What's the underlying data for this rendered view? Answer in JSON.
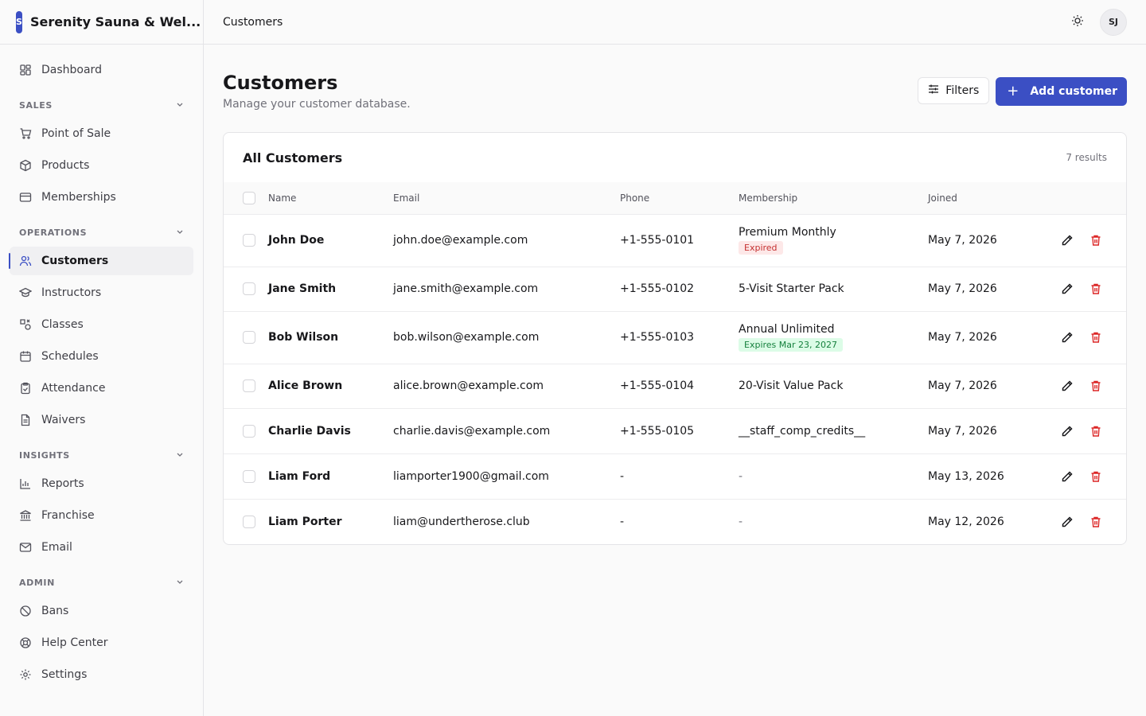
{
  "app": {
    "logo_letter": "S",
    "name": "Serenity Sauna & Wel..."
  },
  "topbar": {
    "breadcrumb": "Customers",
    "avatar_initials": "SJ"
  },
  "sidebar": {
    "dashboard": "Dashboard",
    "sections": {
      "sales": "SALES",
      "operations": "OPERATIONS",
      "insights": "INSIGHTS",
      "admin": "ADMIN"
    },
    "items": {
      "point_of_sale": "Point of Sale",
      "products": "Products",
      "memberships": "Memberships",
      "customers": "Customers",
      "instructors": "Instructors",
      "classes": "Classes",
      "schedules": "Schedules",
      "attendance": "Attendance",
      "waivers": "Waivers",
      "reports": "Reports",
      "franchise": "Franchise",
      "email": "Email",
      "bans": "Bans",
      "help_center": "Help Center",
      "settings": "Settings"
    }
  },
  "page": {
    "title": "Customers",
    "subtitle": "Manage your customer database.",
    "filters_label": "Filters",
    "add_label": "Add customer"
  },
  "table": {
    "title": "All Customers",
    "count": "7 results",
    "columns": {
      "name": "Name",
      "email": "Email",
      "phone": "Phone",
      "membership": "Membership",
      "joined": "Joined"
    },
    "rows": [
      {
        "name": "John Doe",
        "email": "john.doe@example.com",
        "phone": "+1-555-0101",
        "membership": "Premium Monthly",
        "badge": "Expired",
        "joined": "May 7, 2026"
      },
      {
        "name": "Jane Smith",
        "email": "jane.smith@example.com",
        "phone": "+1-555-0102",
        "membership": "5-Visit Starter Pack",
        "badge": "",
        "joined": "May 7, 2026"
      },
      {
        "name": "Bob Wilson",
        "email": "bob.wilson@example.com",
        "phone": "+1-555-0103",
        "membership": "Annual Unlimited",
        "badge": "Expires Mar 23, 2027",
        "joined": "May 7, 2026"
      },
      {
        "name": "Alice Brown",
        "email": "alice.brown@example.com",
        "phone": "+1-555-0104",
        "membership": "20-Visit Value Pack",
        "badge": "",
        "joined": "May 7, 2026"
      },
      {
        "name": "Charlie Davis",
        "email": "charlie.davis@example.com",
        "phone": "+1-555-0105",
        "membership": "__staff_comp_credits__",
        "badge": "",
        "joined": "May 7, 2026"
      },
      {
        "name": "Liam Ford",
        "email": "liamporter1900@gmail.com",
        "phone": "-",
        "membership": "-",
        "badge": "",
        "joined": "May 13, 2026"
      },
      {
        "name": "Liam Porter",
        "email": "liam@undertherose.club",
        "phone": "-",
        "membership": "-",
        "badge": "",
        "joined": "May 12, 2026"
      }
    ]
  },
  "colors": {
    "accent": "#3b4fc4",
    "danger": "#dc2626",
    "success_bg": "#dcfce7"
  }
}
